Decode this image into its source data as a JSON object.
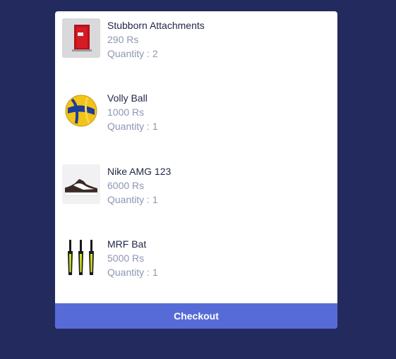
{
  "cart": {
    "items": [
      {
        "name": "Stubborn Attachments",
        "price": "290 Rs",
        "quantity_label": "Quantity :",
        "quantity": "2",
        "image_icon": "book-icon"
      },
      {
        "name": "Volly Ball",
        "price": "1000 Rs",
        "quantity_label": "Quantity :",
        "quantity": "1",
        "image_icon": "volleyball-icon"
      },
      {
        "name": "Nike AMG 123",
        "price": "6000 Rs",
        "quantity_label": "Quantity :",
        "quantity": "1",
        "image_icon": "sneaker-icon"
      },
      {
        "name": "MRF Bat",
        "price": "5000 Rs",
        "quantity_label": "Quantity :",
        "quantity": "1",
        "image_icon": "cricket-bat-icon"
      }
    ],
    "checkout_label": "Checkout"
  },
  "colors": {
    "background": "#232a5e",
    "accent": "#576bd8",
    "text": "#1f2547",
    "muted": "#8e96b3"
  }
}
